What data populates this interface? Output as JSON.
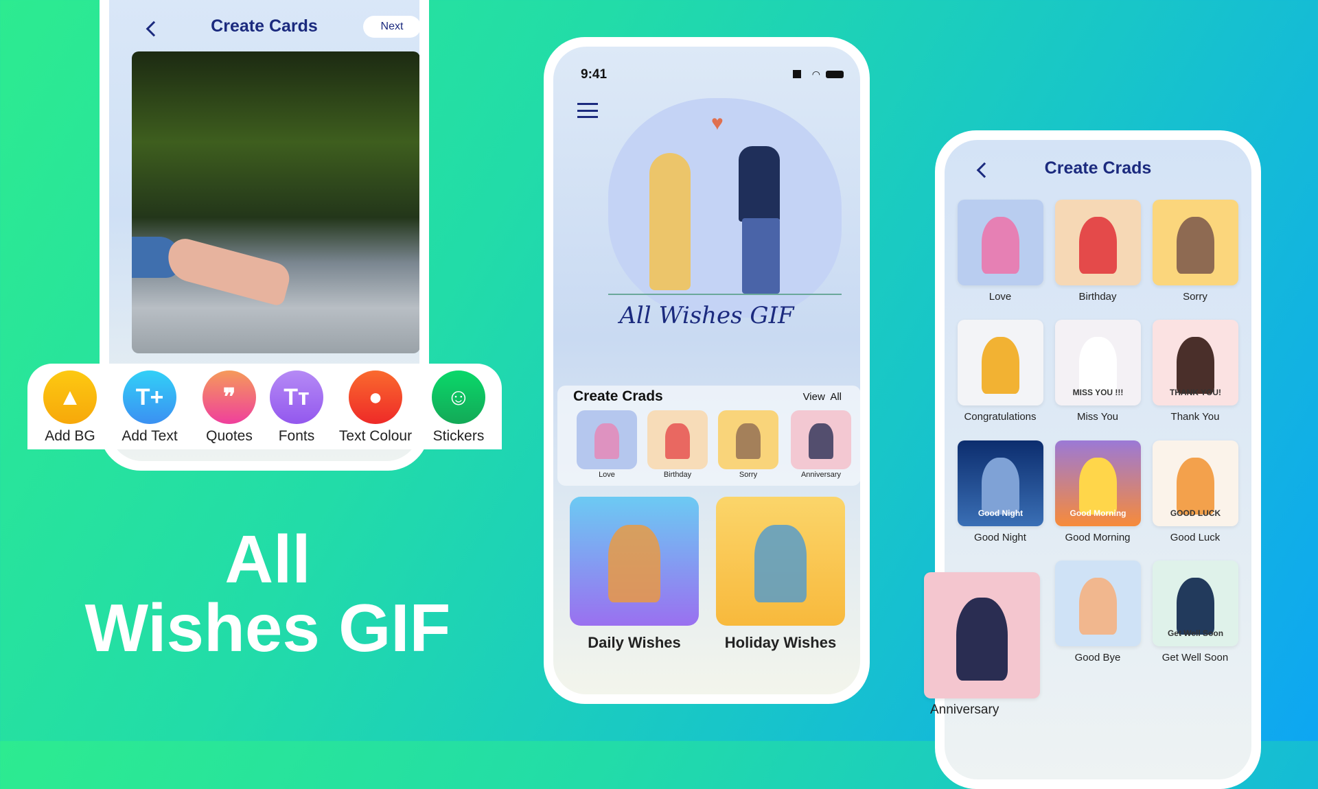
{
  "editor": {
    "title": "Create Cards",
    "next": "Next",
    "tools": [
      {
        "label": "Add BG",
        "icon": "image-icon",
        "color": "#fbb80a"
      },
      {
        "label": "Add Text",
        "icon": "add-text-icon",
        "color": "#36a8f4"
      },
      {
        "label": "Quotes",
        "icon": "quote-icon",
        "color": "#f25c8a"
      },
      {
        "label": "Fonts",
        "icon": "font-icon",
        "color": "#a06cf0"
      },
      {
        "label": "Text Colour",
        "icon": "palette-icon",
        "color": "#f2442a"
      },
      {
        "label": "Stickers",
        "icon": "sticker-icon",
        "color": "#15c55e"
      }
    ]
  },
  "headline": {
    "line1": "All",
    "line2": "Wishes GIF"
  },
  "home": {
    "time": "9:41",
    "logo": "All Wishes GIF",
    "section_title": "Create Crads",
    "view_all": "View  All",
    "categories": [
      "Love",
      "Birthday",
      "Sorry",
      "Anniversary"
    ],
    "big_cards": [
      "Daily Wishes",
      "Holiday Wishes"
    ]
  },
  "cards_screen": {
    "title": "Create Crads",
    "cards": [
      "Love",
      "Birthday",
      "Sorry",
      "Congratulations",
      "Miss You",
      "Thank You",
      "Good Night",
      "Good Morning",
      "Good Luck",
      "Good Bye",
      "Get Well Soon"
    ],
    "featured": "Anniversary",
    "card_texts": {
      "miss": "MISS YOU !!!",
      "thanks": "THANK YOU!",
      "night": "Good Night",
      "morning": "Good Morning",
      "luck": "GOOD LUCK",
      "getwell": "Get Well Soon"
    }
  }
}
